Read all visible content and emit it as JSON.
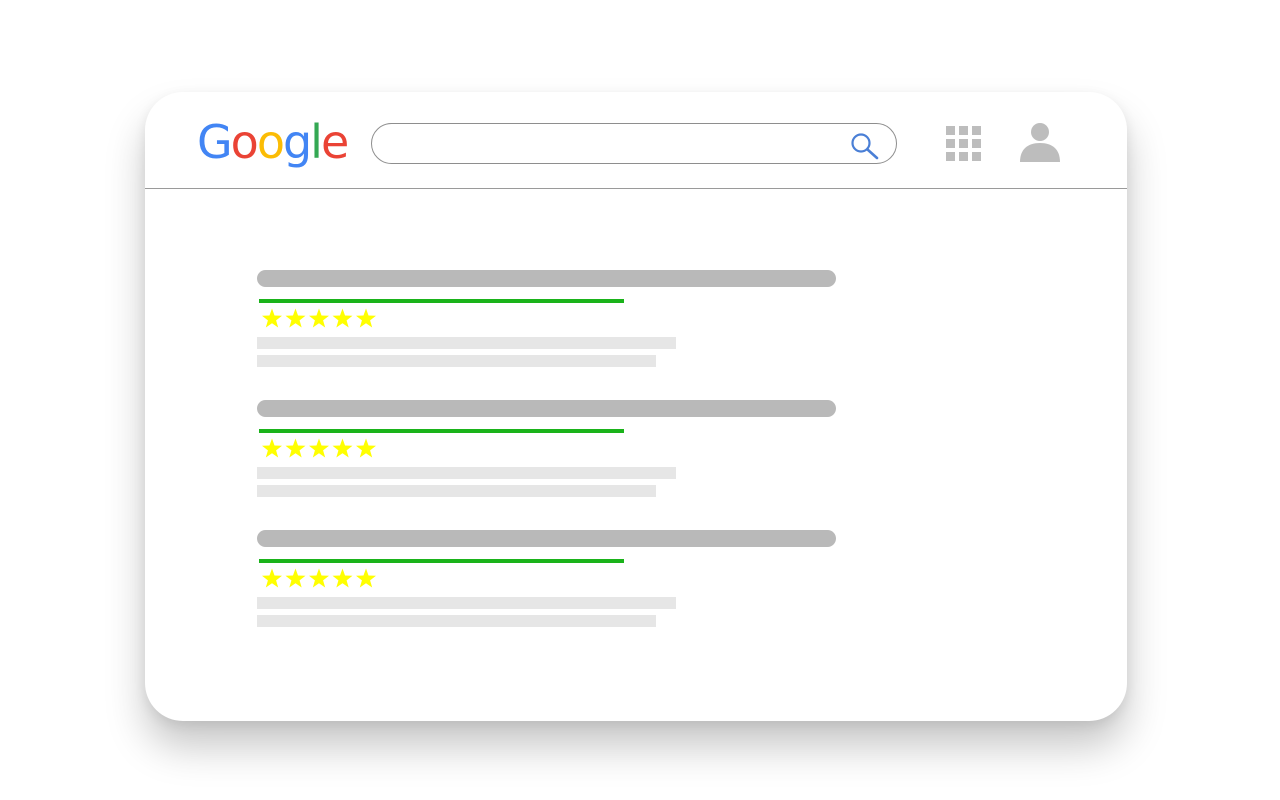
{
  "colors": {
    "google_blue": "#4285F4",
    "google_red": "#EA4335",
    "google_yellow": "#FBBC05",
    "google_green": "#34A853",
    "placeholder_dark": "#b9b9b9",
    "placeholder_light": "#e6e6e6",
    "url_green": "#1ab31a",
    "star_yellow": "#ffff00",
    "icon_gray": "#bdbdbd"
  },
  "header": {
    "logo_letters": [
      {
        "char": "G",
        "color": "#4285F4"
      },
      {
        "char": "o",
        "color": "#EA4335"
      },
      {
        "char": "o",
        "color": "#FBBC05"
      },
      {
        "char": "g",
        "color": "#4285F4"
      },
      {
        "char": "l",
        "color": "#34A853"
      },
      {
        "char": "e",
        "color": "#EA4335"
      }
    ],
    "search": {
      "value": "",
      "placeholder": "",
      "icon": "search-icon"
    },
    "apps_icon": "apps-grid-icon",
    "account_icon": "user-avatar-icon"
  },
  "results": [
    {
      "rating": 5,
      "max_rating": 5
    },
    {
      "rating": 5,
      "max_rating": 5
    },
    {
      "rating": 5,
      "max_rating": 5
    }
  ]
}
